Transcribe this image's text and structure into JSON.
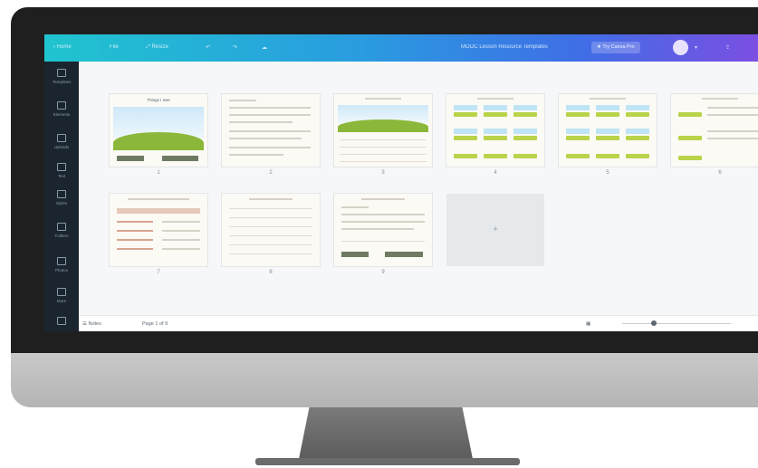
{
  "topbar": {
    "home_label": "Home",
    "file_label": "File",
    "resize_label": "Resize",
    "document_title": "MOOC Lesson Resource Templates",
    "share_label": "Try Canva Pro"
  },
  "sidebar": {
    "items": [
      {
        "label": "Templates",
        "icon": "template-icon"
      },
      {
        "label": "Elements",
        "icon": "elements-icon"
      },
      {
        "label": "Uploads",
        "icon": "upload-icon"
      },
      {
        "label": "Text",
        "icon": "text-icon"
      },
      {
        "label": "Styles",
        "icon": "styles-icon"
      },
      {
        "label": "Folders",
        "icon": "folder-icon"
      },
      {
        "label": "Photos",
        "icon": "photo-icon"
      },
      {
        "label": "More",
        "icon": "more-icon"
      }
    ]
  },
  "pages": [
    {
      "number": "1",
      "title": "Things I See"
    },
    {
      "number": "2",
      "title": ""
    },
    {
      "number": "3",
      "title": ""
    },
    {
      "number": "4",
      "title": ""
    },
    {
      "number": "5",
      "title": ""
    },
    {
      "number": "6",
      "title": ""
    },
    {
      "number": "7",
      "title": ""
    },
    {
      "number": "8",
      "title": ""
    },
    {
      "number": "9",
      "title": ""
    }
  ],
  "add_page_symbol": "+",
  "bottombar": {
    "notes_label": "Notes",
    "page_indicator": "Page 1 of 9"
  },
  "colors": {
    "topbar_start": "#20c4cf",
    "topbar_end": "#7b4fe3",
    "sidebar_bg": "#1b2530",
    "accent_green": "#8bb83a"
  }
}
